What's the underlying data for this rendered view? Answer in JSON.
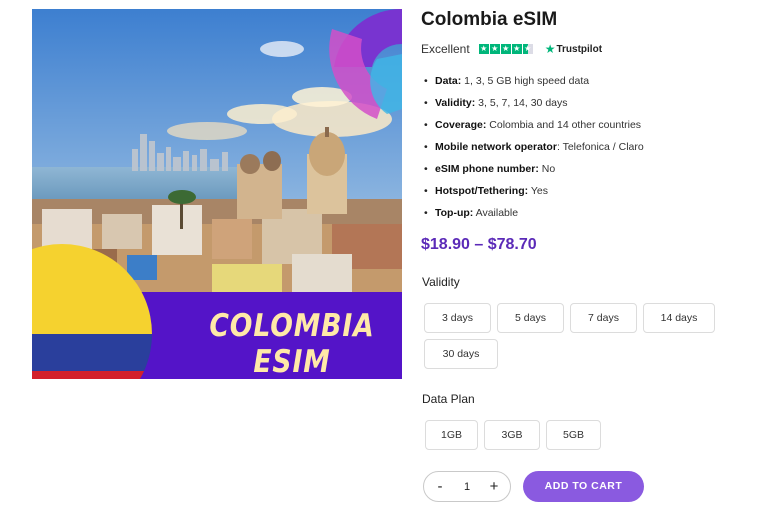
{
  "product": {
    "title": "Colombia eSIM",
    "rating_label": "Excellent",
    "rating_provider": "Trustpilot",
    "image_text": {
      "line1": "COLOMBIA",
      "line2": "ESIM"
    },
    "specs": [
      {
        "key": "Data:",
        "value": " 1, 3, 5 GB high speed data"
      },
      {
        "key": "Validity:",
        "value": " 3, 5, 7, 14, 30 days"
      },
      {
        "key": "Coverage:",
        "value": " Colombia and 14 other countries"
      },
      {
        "key": "Mobile network operator",
        "value": ": Telefonica / Claro"
      },
      {
        "key": "eSIM phone number:",
        "value": " No"
      },
      {
        "key": "Hotspot/Tethering:",
        "value": " Yes"
      },
      {
        "key": "Top-up:",
        "value": " Available"
      }
    ],
    "price": "$18.90 – $78.70"
  },
  "validity": {
    "label": "Validity",
    "options": [
      "3 days",
      "5 days",
      "7 days",
      "14 days",
      "30 days"
    ]
  },
  "data_plan": {
    "label": "Data Plan",
    "options": [
      "1GB",
      "3GB",
      "5GB"
    ]
  },
  "cart": {
    "minus": "-",
    "quantity": "1",
    "plus": "+",
    "add_label": "ADD TO CART"
  },
  "colors": {
    "accent": "#8a5ae0",
    "price": "#5b2ab8",
    "trustpilot": "#00b67a",
    "banner": "#5414c8",
    "flag_yellow": "#f5d22f",
    "flag_blue": "#2a3f9c",
    "flag_red": "#d3202a"
  }
}
